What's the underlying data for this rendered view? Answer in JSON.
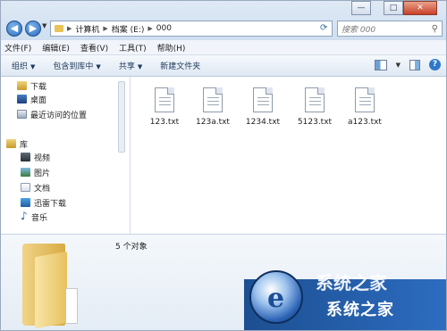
{
  "window": {
    "minimize_label": "—",
    "maximize_label": "□",
    "close_label": "✕"
  },
  "address": {
    "path": [
      "计算机",
      "档案 (E:)",
      "000"
    ],
    "search_placeholder": "搜索 000"
  },
  "menu": [
    "文件(F)",
    "编辑(E)",
    "查看(V)",
    "工具(T)",
    "帮助(H)"
  ],
  "toolbar": {
    "organize": "组织",
    "include_library": "包含到库中",
    "share": "共享",
    "new_folder": "新建文件夹"
  },
  "nav": {
    "favorites": [
      "下载",
      "桌面",
      "最近访问的位置"
    ],
    "library_label": "库",
    "libraries": [
      "视频",
      "图片",
      "文档",
      "迅雷下载",
      "音乐"
    ]
  },
  "files": [
    {
      "name": "123.txt"
    },
    {
      "name": "123a.txt"
    },
    {
      "name": "1234.txt"
    },
    {
      "name": "5123.txt"
    },
    {
      "name": "a123.txt"
    }
  ],
  "details": {
    "count_text": "5 个对象"
  },
  "watermark": {
    "brand_text": "系统之家",
    "top_text": "系统之家"
  }
}
